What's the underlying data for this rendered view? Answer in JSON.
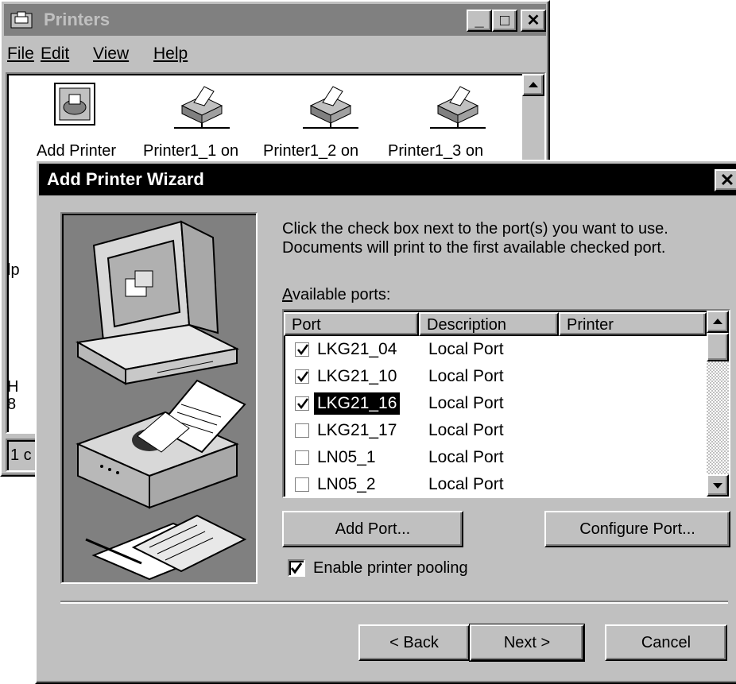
{
  "printers_window": {
    "title": "Printers",
    "menu": [
      "File",
      "Edit",
      "View",
      "Help"
    ],
    "icons": [
      "Add Printer",
      "Printer1_1 on",
      "Printer1_2 on",
      "Printer1_3 on"
    ],
    "partial_labels": {
      "left1": "lp",
      "left2": "H",
      "left3": "8"
    },
    "status_text": "1 c",
    "minimize_glyph": "_",
    "maximize_glyph": "□",
    "close_glyph": "✕"
  },
  "wizard": {
    "title": "Add Printer Wizard",
    "close_glyph": "✕",
    "instructions_line1": "Click the check box next to the port(s) you want to use.",
    "instructions_line2": "Documents will print to the first available checked port.",
    "available_ports_label": "Available ports:",
    "columns": [
      "Port",
      "Description",
      "Printer"
    ],
    "ports": [
      {
        "port": "LKG21_04",
        "description": "Local Port",
        "printer": "",
        "checked": true,
        "selected": false
      },
      {
        "port": "LKG21_10",
        "description": "Local Port",
        "printer": "",
        "checked": true,
        "selected": false
      },
      {
        "port": "LKG21_16",
        "description": "Local Port",
        "printer": "",
        "checked": true,
        "selected": true
      },
      {
        "port": "LKG21_17",
        "description": "Local Port",
        "printer": "",
        "checked": false,
        "selected": false
      },
      {
        "port": "LN05_1",
        "description": "Local Port",
        "printer": "",
        "checked": false,
        "selected": false
      },
      {
        "port": "LN05_2",
        "description": "Local Port",
        "printer": "",
        "checked": false,
        "selected": false
      }
    ],
    "add_port_label": "Add Port...",
    "configure_port_label": "Configure Port...",
    "pooling_label": "Enable printer pooling",
    "pooling_checked": true,
    "back_label": "< Back",
    "next_label": "Next >",
    "cancel_label": "Cancel"
  },
  "colors": {
    "inactive_title": "#808080",
    "active_title": "#000000",
    "face": "#c0c0c0",
    "selection": "#000000"
  }
}
